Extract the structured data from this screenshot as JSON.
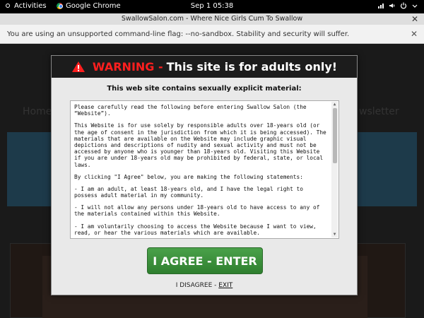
{
  "system_bar": {
    "activities": "Activities",
    "app_name": "Google Chrome",
    "clock": "Sep 1  05:38",
    "tray_icons": [
      "network-icon",
      "volume-icon",
      "power-icon"
    ]
  },
  "window": {
    "title": "SwallowSalon.com - Where Nice Girls Cum To Swallow"
  },
  "infobar": {
    "message": "You are using an unsupported command-line flag: --no-sandbox. Stability and security will suffer."
  },
  "background_page": {
    "nav_left": "Home",
    "nav_right": "wsletter"
  },
  "modal": {
    "warning_word": "WARNING -",
    "warning_rest": "This site is for adults only!",
    "subtitle": "This web site contains sexually explicit material:",
    "terms_paragraphs": [
      "Please carefully read the following before entering Swallow Salon (the “Website”).",
      "This Website is for use solely by responsible adults over 18-years old (or the age of consent in the jurisdiction from which it is being accessed). The materials that are available on the Website may include graphic visual depictions and descriptions of nudity and sexual activity and must not be accessed by anyone who is younger than 18-years old. Visiting this Website if you are under 18-years old may be prohibited by federal, state, or local laws.",
      "By clicking \"I Agree\" below, you are making the following statements:",
      "- I am an adult, at least 18-years old, and I have the legal right to possess adult material in my community.",
      "- I will not allow any persons under 18-years old to have access to any of the materials contained within this Website.",
      "- I am voluntarily choosing to access the Website because I want to view, read, or hear the various materials which are available."
    ],
    "agree_button": "I AGREE - ENTER",
    "disagree_prefix": "I DISAGREE - ",
    "exit_link": "EXIT"
  },
  "colors": {
    "warning_red": "#ff1f1f",
    "agree_green": "#3a913a",
    "header_dark": "#1c1c1c"
  }
}
